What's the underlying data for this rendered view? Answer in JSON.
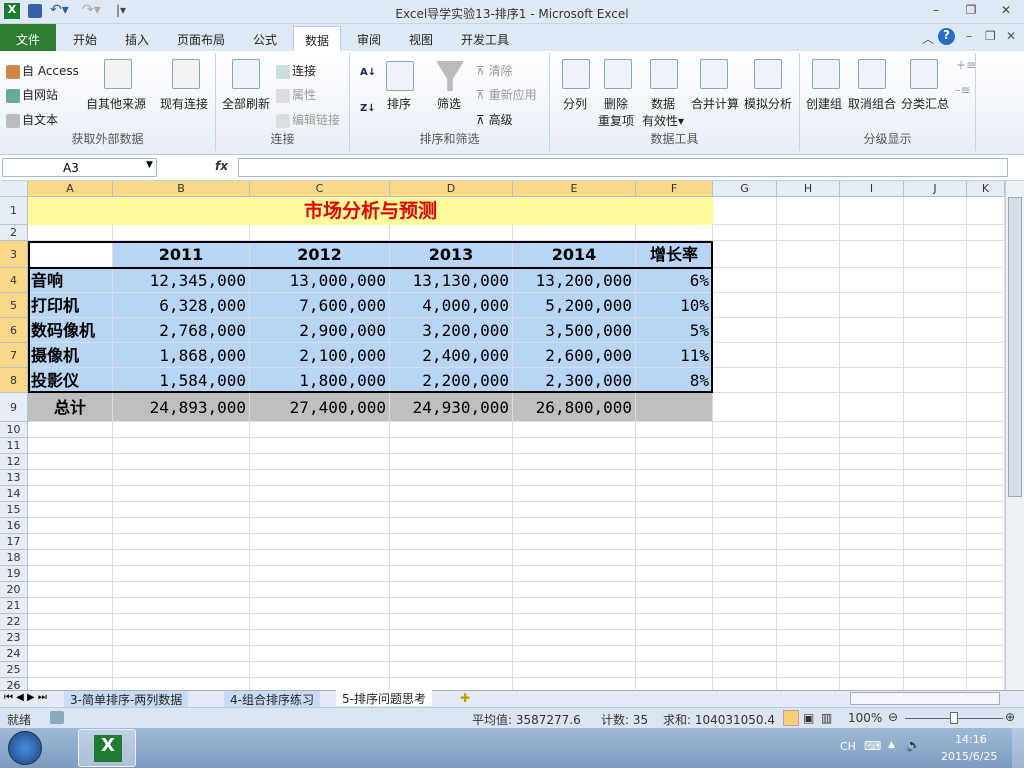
{
  "window": {
    "title": "Excel导学实验13-排序1  -  Microsoft Excel"
  },
  "quick_access": [
    "save",
    "undo",
    "redo",
    "customize"
  ],
  "tabs": [
    {
      "label": "文件"
    },
    {
      "label": "开始"
    },
    {
      "label": "插入"
    },
    {
      "label": "页面布局"
    },
    {
      "label": "公式"
    },
    {
      "label": "数据"
    },
    {
      "label": "审阅"
    },
    {
      "label": "视图"
    },
    {
      "label": "开发工具"
    }
  ],
  "ribbon": {
    "groups": [
      {
        "label": "获取外部数据",
        "items": [
          "自 Access",
          "自网站",
          "自文本",
          "自其他来源",
          "现有连接"
        ]
      },
      {
        "label": "连接",
        "items": [
          "全部刷新",
          "连接",
          "属性",
          "编辑链接"
        ]
      },
      {
        "label": "排序和筛选",
        "items": [
          "排序",
          "筛选",
          "清除",
          "重新应用",
          "高级"
        ]
      },
      {
        "label": "数据工具",
        "items": [
          "分列",
          "删除",
          "重复项",
          "数据",
          "有效性",
          "合并计算",
          "模拟分析"
        ]
      },
      {
        "label": "分级显示",
        "items": [
          "创建组",
          "取消组合",
          "分类汇总"
        ]
      }
    ]
  },
  "formula_bar": {
    "name_box": "A3",
    "fx": "fx",
    "formula": ""
  },
  "columns": [
    "A",
    "B",
    "C",
    "D",
    "E",
    "F",
    "G",
    "H",
    "I",
    "J",
    "K"
  ],
  "sheet": {
    "title": "市场分析与预测",
    "header": [
      "",
      "2011",
      "2012",
      "2013",
      "2014",
      "增长率"
    ],
    "rows": [
      [
        "音响",
        "12,345,000",
        "13,000,000",
        "13,130,000",
        "13,200,000",
        "6%"
      ],
      [
        "打印机",
        "6,328,000",
        "7,600,000",
        "4,000,000",
        "5,200,000",
        "10%"
      ],
      [
        "数码像机",
        "2,768,000",
        "2,900,000",
        "3,200,000",
        "3,500,000",
        "5%"
      ],
      [
        "摄像机",
        "1,868,000",
        "2,100,000",
        "2,400,000",
        "2,600,000",
        "11%"
      ],
      [
        "投影仪",
        "1,584,000",
        "1,800,000",
        "2,200,000",
        "2,300,000",
        "8%"
      ]
    ],
    "total": [
      "总计",
      "24,893,000",
      "27,400,000",
      "24,930,000",
      "26,800,000",
      ""
    ]
  },
  "sheet_tabs": [
    {
      "label": "3-简单排序-两列数据"
    },
    {
      "label": "4-组合排序练习"
    },
    {
      "label": "5-排序问题思考"
    }
  ],
  "status": {
    "ready": "就绪",
    "average": "平均值: 3587277.6",
    "count": "计数: 35",
    "sum": "求和: 104031050.4",
    "zoom": "100%"
  },
  "taskbar": {
    "lang": "CH",
    "time": "14:16",
    "date": "2015/6/25"
  }
}
